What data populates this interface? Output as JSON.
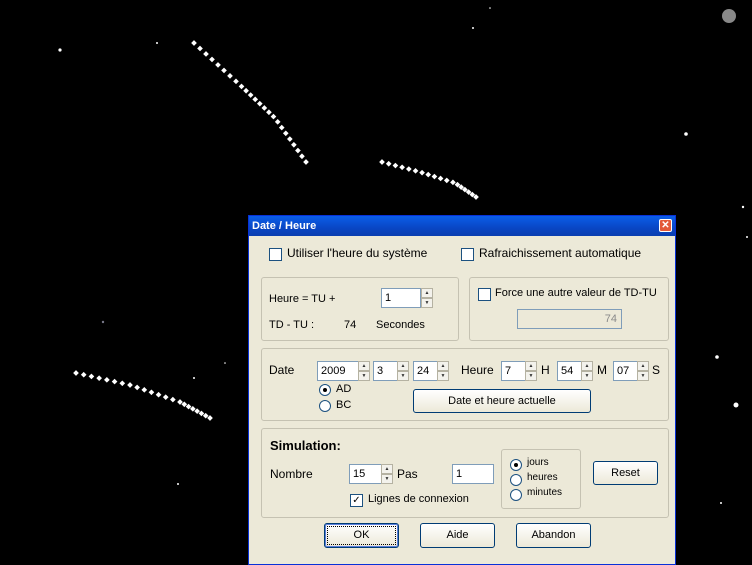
{
  "dialog": {
    "title": "Date / Heure",
    "close_glyph": "✕",
    "use_system_time": {
      "label": "Utiliser l'heure du système",
      "checked": false
    },
    "auto_refresh": {
      "label": "Rafraichissement automatique",
      "checked": false
    },
    "tu": {
      "label": "Heure = TU +",
      "value": "1",
      "tdtu_label": "TD - TU  :",
      "tdtu_value": "74",
      "tdtu_unit": "Secondes",
      "force_label": "Force une autre valeur de TD-TU",
      "force_checked": false,
      "force_value": "74"
    },
    "date": {
      "label": "Date",
      "year": "2009",
      "month": "3",
      "day": "24",
      "hour_label": "Heure",
      "hour": "7",
      "h_label": "H",
      "minute": "54",
      "m_label": "M",
      "second": "07",
      "s_label": "S",
      "era_ad": "AD",
      "era_bc": "BC",
      "era_selected": "AD",
      "now_button": "Date et heure actuelle"
    },
    "simulation": {
      "heading": "Simulation:",
      "count_label": "Nombre",
      "count_value": "15",
      "step_label": "Pas",
      "step_value": "1",
      "units": [
        "jours",
        "heures",
        "minutes"
      ],
      "unit_selected": "jours",
      "reset_button": "Reset",
      "connection_lines_label": "Lignes de connexion",
      "connection_lines_checked": true
    },
    "buttons": {
      "ok": "OK",
      "help": "Aide",
      "cancel": "Abandon"
    }
  }
}
